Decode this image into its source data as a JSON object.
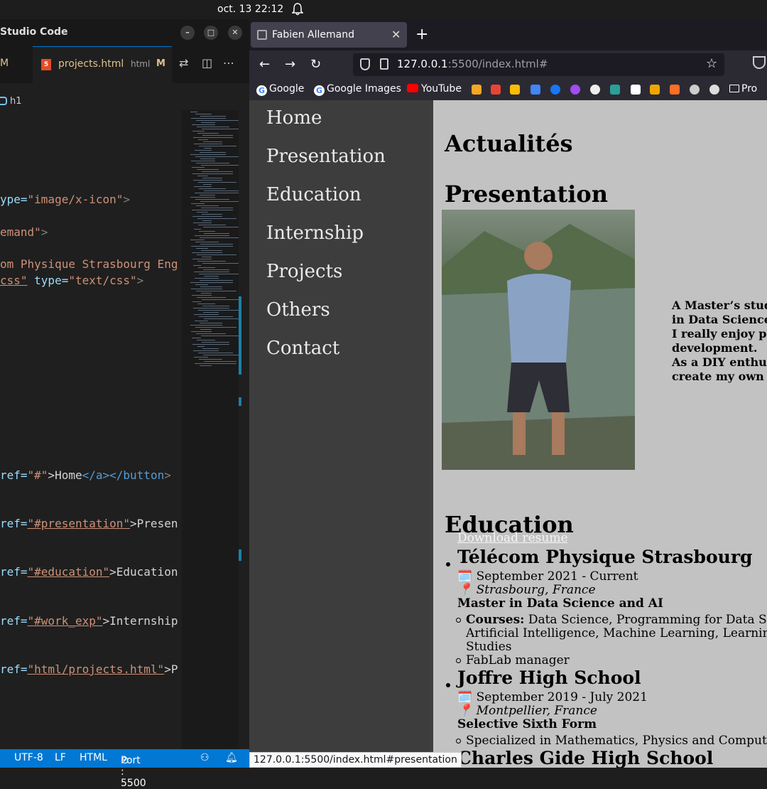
{
  "system": {
    "clock": "oct. 13  22:12"
  },
  "vscode": {
    "title": "Studio Code",
    "tab_prev_modified": "M",
    "tab": {
      "name": "projects.html",
      "lang": "html",
      "modified": "M"
    },
    "breadcrumb": "h1",
    "code": {
      "l1": {
        "a": "ype=",
        "b": "\"image/x-icon\"",
        "c": ">"
      },
      "l2": {
        "a": "emand\"",
        "b": ">"
      },
      "l3": "om Physique Strasbourg Eng",
      "l4": {
        "a": "css\"",
        "b": " type=",
        "c": "\"text/css\"",
        "d": ">"
      },
      "l5": {
        "a": "ref=",
        "b": "\"#\"",
        "c": ">Home",
        "d": "</a></button",
        "e": ">"
      },
      "l6": {
        "a": "ref=",
        "b": "\"#presentation\"",
        "c": ">Presen"
      },
      "l7": {
        "a": "ref=",
        "b": "\"#education\"",
        "c": ">Education"
      },
      "l8": {
        "a": "ref=",
        "b": "\"#work_exp\"",
        "c": ">Internship"
      },
      "l9": {
        "a": "ref=",
        "b": "\"html/projects.html\"",
        "c": ">P"
      }
    },
    "status": {
      "encoding": "UTF-8",
      "eol": "LF",
      "language": "HTML",
      "port": "Port : 5500"
    }
  },
  "browser": {
    "tab_title": "Fabien Allemand",
    "url": {
      "host": "127.0.0.1",
      "rest": ":5500/index.html#"
    },
    "bookmarks": {
      "google": "Google",
      "google_images": "Google Images",
      "youtube": "YouTube",
      "pro": "Pro"
    },
    "status_url": "127.0.0.1:5500/index.html#presentation"
  },
  "site": {
    "nav": [
      "Home",
      "Presentation",
      "Education",
      "Internship",
      "Projects",
      "Others",
      "Contact"
    ],
    "h_news": "Actualités",
    "h_presentation": "Presentation",
    "intro": [
      "A Master’s stud",
      "in Data Science",
      "I really enjoy p",
      "development.",
      "As a DIY enthu",
      "create my own"
    ],
    "h_education": "Education",
    "download": "Download resume",
    "schools": [
      {
        "name": "Télécom Physique Strasbourg",
        "date": "🗓️ September 2021 - Current",
        "place": "📍 Strasbourg, France",
        "degree": "Master in Data Science and AI",
        "courses_label": "Courses:",
        "courses_l1": " Data Science, Programming for Data Scien",
        "courses_l2": "Artificial Intelligence, Machine Learning, Learning S",
        "courses_l3": "Studies",
        "extra": "FabLab manager"
      },
      {
        "name": "Joffre High School",
        "date": "🗓️ September 2019 - July 2021",
        "place": "📍 Montpellier, France",
        "degree": "Selective Sixth Form",
        "extra": "Specialized in Mathematics, Physics and Computer S"
      },
      {
        "name": "Charles Gide High School"
      }
    ]
  }
}
